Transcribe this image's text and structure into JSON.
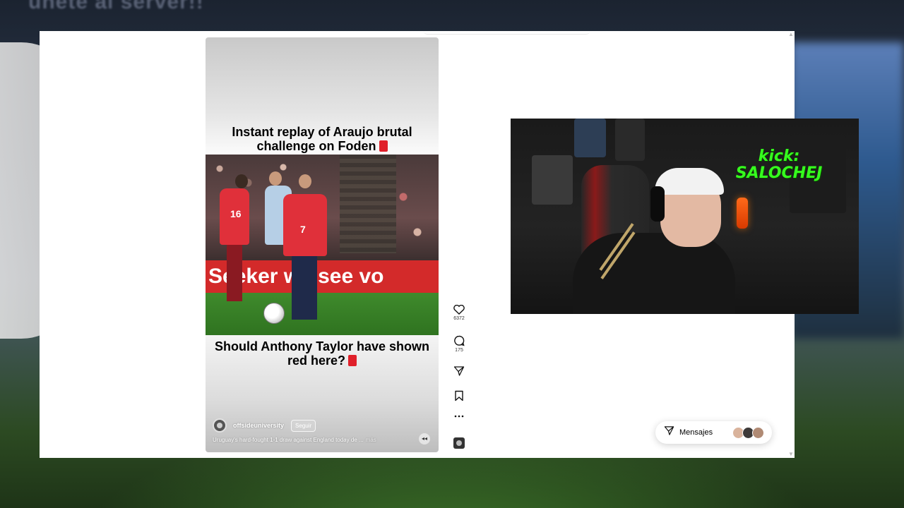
{
  "background": {
    "title_partial": "únete al server!!"
  },
  "reel": {
    "headline_top": "Instant replay of Araujo brutal challenge on Foden",
    "headline_bottom": "Should Anthony Taylor have shown red here?",
    "ad_board_text": "Seeker we see vo",
    "account": {
      "name": "offsideuniversity",
      "follow_label": "Seguir"
    },
    "caption": "Uruguay's hard-fought 1-1 draw against England today de ...",
    "caption_more": "más"
  },
  "actions": {
    "likes": "6372",
    "comments": "175"
  },
  "messages": {
    "label": "Mensajes"
  },
  "webcam": {
    "overlay_text_line1": "kick:",
    "overlay_text_line2": "SALOCHEJ"
  },
  "colors": {
    "accent_green": "#36ff1e",
    "ad_red": "#d32a2a",
    "kit_red": "#e0303a"
  }
}
